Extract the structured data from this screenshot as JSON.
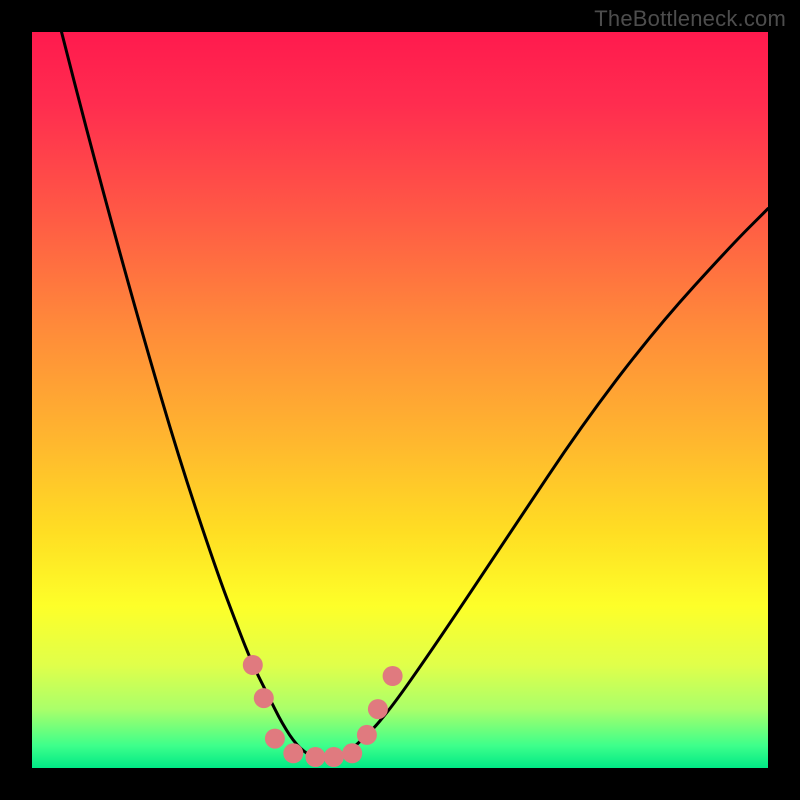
{
  "watermark": "TheBottleneck.com",
  "chart_data": {
    "type": "line",
    "title": "",
    "xlabel": "",
    "ylabel": "",
    "xlim": [
      0,
      100
    ],
    "ylim": [
      0,
      100
    ],
    "series": [
      {
        "name": "curve",
        "x": [
          0,
          5,
          10,
          15,
          20,
          25,
          28,
          30,
          32,
          34,
          36,
          38,
          40,
          42,
          44,
          48,
          55,
          65,
          75,
          85,
          95,
          100
        ],
        "values": [
          116,
          96,
          77,
          59,
          42,
          27,
          19,
          14,
          10,
          6,
          3,
          1.5,
          1,
          1.5,
          3,
          7,
          17,
          32,
          47,
          60,
          71,
          76
        ]
      }
    ],
    "markers": {
      "color": "#e07a7f",
      "radius": 10,
      "points": [
        {
          "x": 30.0,
          "y": 14.0
        },
        {
          "x": 31.5,
          "y": 9.5
        },
        {
          "x": 33.0,
          "y": 4.0
        },
        {
          "x": 35.5,
          "y": 2.0
        },
        {
          "x": 38.5,
          "y": 1.5
        },
        {
          "x": 41.0,
          "y": 1.5
        },
        {
          "x": 43.5,
          "y": 2.0
        },
        {
          "x": 45.5,
          "y": 4.5
        },
        {
          "x": 47.0,
          "y": 8.0
        },
        {
          "x": 49.0,
          "y": 12.5
        }
      ]
    },
    "gradient_stops": [
      {
        "pos": 0.0,
        "color": "#ff1a4e"
      },
      {
        "pos": 0.25,
        "color": "#ff5a45"
      },
      {
        "pos": 0.55,
        "color": "#ffb52f"
      },
      {
        "pos": 0.78,
        "color": "#fdff29"
      },
      {
        "pos": 0.97,
        "color": "#3dff8b"
      },
      {
        "pos": 1.0,
        "color": "#00e985"
      }
    ]
  }
}
